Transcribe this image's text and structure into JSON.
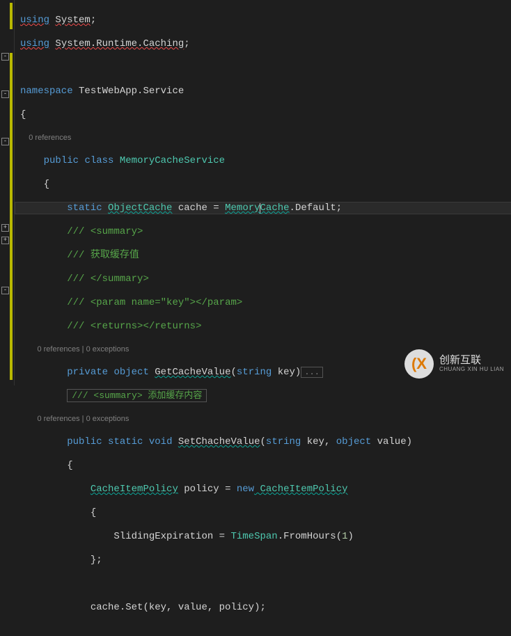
{
  "code": {
    "l1_using": "using",
    "l1_system": "System",
    "l2_using": "using",
    "l2_ns": "System.Runtime.Caching",
    "l4_ns_kw": "namespace",
    "l4_ns_name": "TestWebApp.Service",
    "brace_open": "{",
    "brace_close": "}",
    "cl_0ref": "0 references",
    "l7_public": "public",
    "l7_class": "class",
    "l7_name": "MemoryCacheService",
    "l9_static": "static",
    "l9_type": "ObjectCache",
    "l9_var": "cache",
    "l9_eq": " = ",
    "l9_memory": "Memory",
    "l9_cache": "Cache",
    "l9_default": ".Default;",
    "c_sl": "///",
    "c_summary_open": " <summary>",
    "c_get_zh": " 获取缓存值",
    "c_summary_close": " </summary>",
    "c_param": " <param name=",
    "c_param_key": "\"key\"",
    "c_param_close": "></param>",
    "c_returns": " <returns></returns>",
    "cl_0ref_0ex": "0 references | 0 exceptions",
    "m1_private": "private",
    "m1_object": "object",
    "m1_name": "GetCacheValue",
    "m1_po": "(",
    "m1_string": "string",
    "m1_key": " key)",
    "m1_dots": "...",
    "collapsed_summary": "/// <summary> 添加缓存内容",
    "m2_public": "public",
    "m2_static": "static",
    "m2_void": "void",
    "m2_name": "SetChacheValue",
    "m2_po": "(",
    "m2_string1": "string",
    "m2_key": " key, ",
    "m2_object": "object",
    "m2_value": " value)",
    "p_type": "CacheItemPolicy",
    "p_var": " policy = ",
    "p_new": "new",
    "p_type2": " CacheItemPolicy",
    "p_sliding": "SlidingExpiration",
    "p_eq": " = ",
    "p_timespan": "TimeSpan",
    "p_fromhours": ".FromHours(",
    "p_one": "1",
    "p_close": ")",
    "p_close_brace": "};",
    "set_call": "cache.Set(key, value, policy);"
  },
  "watermark": {
    "logo": "(X",
    "main": "创新互联",
    "sub": "CHUANG XIN HU LIAN"
  }
}
